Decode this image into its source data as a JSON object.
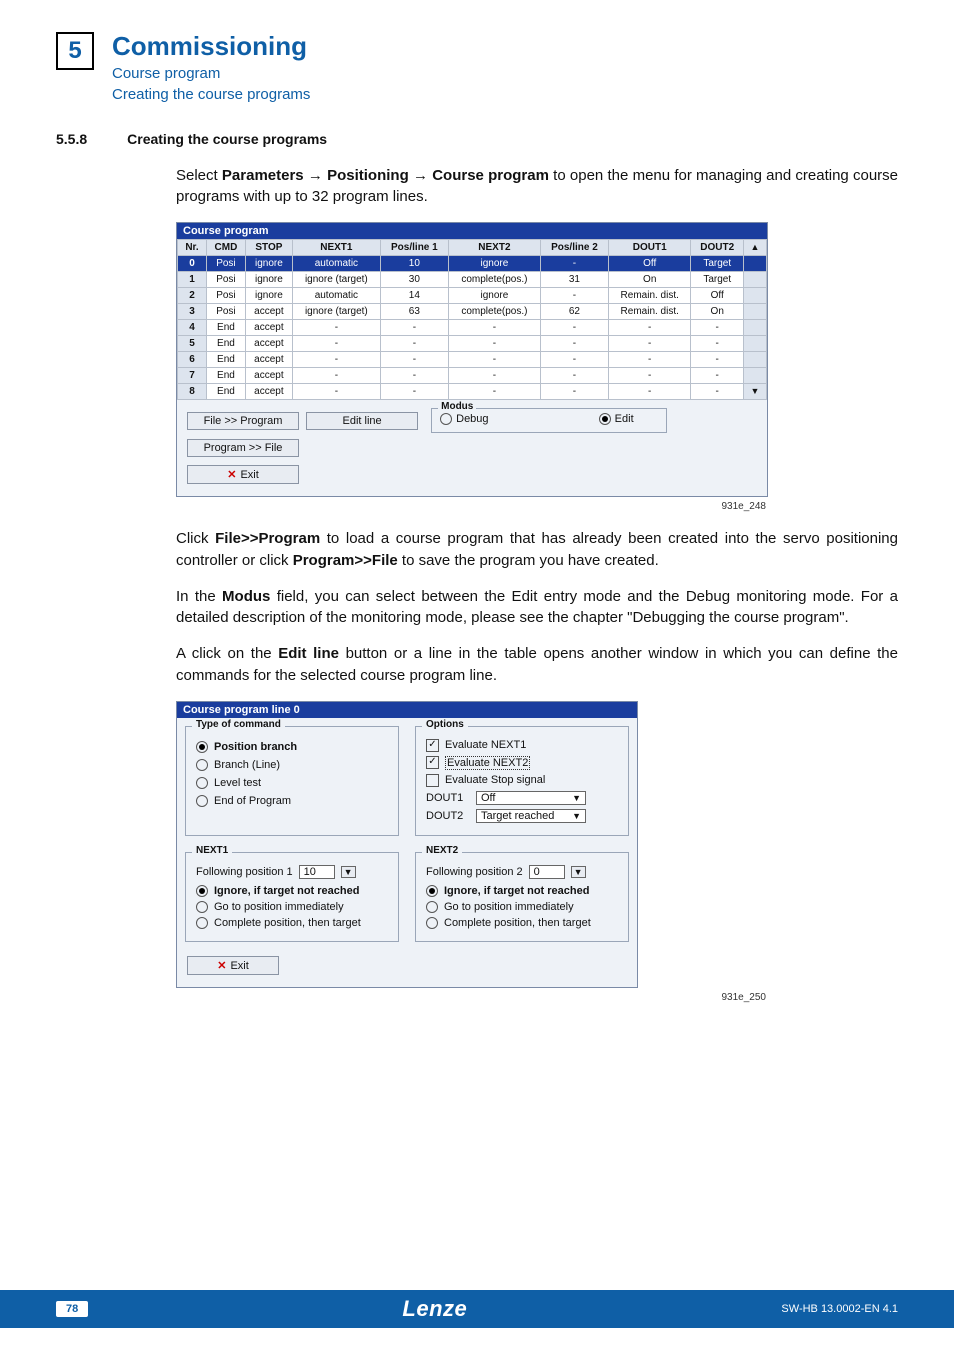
{
  "header": {
    "chapter_number": "5",
    "main_title": "Commissioning",
    "subtitle_1": "Course program",
    "subtitle_2": "Creating the course programs"
  },
  "section": {
    "number": "5.5.8",
    "title": "Creating the course programs"
  },
  "paragraphs": {
    "intro": "Select Parameters → Positioning → Course program to open the menu for managing and creating course programs with up to 32 program lines.",
    "intro_prefix": "Select ",
    "intro_bold1": "Parameters → Positioning → Course program",
    "intro_suffix": " to open the menu for managing and creating course programs with up to 32 program lines.",
    "p2_a": "Click ",
    "p2_bold1": "File>>Program",
    "p2_b": " to load a course program that has already been created into the servo positioning controller or click ",
    "p2_bold2": "Program>>File",
    "p2_c": " to save the program you have created.",
    "p3_a": "In the ",
    "p3_bold": "Modus",
    "p3_b": " field, you can select between the Edit entry mode and the Debug monitoring mode. For a detailed description of the monitoring mode, please see the chapter \"Debugging the course program\".",
    "p4_a": "A click on the ",
    "p4_bold": "Edit line",
    "p4_b": " button or a line in the table opens another window in which you can define the commands for the selected course program line."
  },
  "fig_caption_1": "931e_248",
  "fig_caption_2": "931e_250",
  "course_program_window": {
    "title": "Course program",
    "columns": [
      "Nr.",
      "CMD",
      "STOP",
      "NEXT1",
      "Pos/line 1",
      "NEXT2",
      "Pos/line 2",
      "DOUT1",
      "DOUT2"
    ],
    "rows": [
      {
        "nr": "0",
        "cmd": "Posi",
        "stop": "ignore",
        "next1": "automatic",
        "pl1": "10",
        "next2": "ignore",
        "pl2": "-",
        "d1": "Off",
        "d2": "Target",
        "hl": true
      },
      {
        "nr": "1",
        "cmd": "Posi",
        "stop": "ignore",
        "next1": "ignore (target)",
        "pl1": "30",
        "next2": "complete(pos.)",
        "pl2": "31",
        "d1": "On",
        "d2": "Target"
      },
      {
        "nr": "2",
        "cmd": "Posi",
        "stop": "ignore",
        "next1": "automatic",
        "pl1": "14",
        "next2": "ignore",
        "pl2": "-",
        "d1": "Remain. dist.",
        "d2": "Off"
      },
      {
        "nr": "3",
        "cmd": "Posi",
        "stop": "accept",
        "next1": "ignore (target)",
        "pl1": "63",
        "next2": "complete(pos.)",
        "pl2": "62",
        "d1": "Remain. dist.",
        "d2": "On"
      },
      {
        "nr": "4",
        "cmd": "End",
        "stop": "accept",
        "next1": "-",
        "pl1": "-",
        "next2": "-",
        "pl2": "-",
        "d1": "-",
        "d2": "-"
      },
      {
        "nr": "5",
        "cmd": "End",
        "stop": "accept",
        "next1": "-",
        "pl1": "-",
        "next2": "-",
        "pl2": "-",
        "d1": "-",
        "d2": "-"
      },
      {
        "nr": "6",
        "cmd": "End",
        "stop": "accept",
        "next1": "-",
        "pl1": "-",
        "next2": "-",
        "pl2": "-",
        "d1": "-",
        "d2": "-"
      },
      {
        "nr": "7",
        "cmd": "End",
        "stop": "accept",
        "next1": "-",
        "pl1": "-",
        "next2": "-",
        "pl2": "-",
        "d1": "-",
        "d2": "-"
      },
      {
        "nr": "8",
        "cmd": "End",
        "stop": "accept",
        "next1": "-",
        "pl1": "-",
        "next2": "-",
        "pl2": "-",
        "d1": "-",
        "d2": "-"
      }
    ],
    "buttons": {
      "file_to_program": "File >> Program",
      "edit_line": "Edit line",
      "program_to_file": "Program >> File",
      "exit": "Exit"
    },
    "modus": {
      "legend": "Modus",
      "debug_label": "Debug",
      "edit_label": "Edit",
      "debug_checked": false,
      "edit_checked": true
    }
  },
  "line_window": {
    "title": "Course program line 0",
    "type_of_command": {
      "legend": "Type of command",
      "options": [
        {
          "label": "Position branch",
          "checked": true
        },
        {
          "label": "Branch (Line)",
          "checked": false
        },
        {
          "label": "Level test",
          "checked": false
        },
        {
          "label": "End of Program",
          "checked": false
        }
      ]
    },
    "options_box": {
      "legend": "Options",
      "eval_next1": {
        "label": "Evaluate NEXT1",
        "checked": true
      },
      "eval_next2": {
        "label": "Evaluate NEXT2",
        "checked": true
      },
      "eval_stop": {
        "label": "Evaluate Stop signal",
        "checked": false
      },
      "dout1_label": "DOUT1",
      "dout1_value": "Off",
      "dout2_label": "DOUT2",
      "dout2_value": "Target reached"
    },
    "next1": {
      "legend": "NEXT1",
      "follow_label": "Following position 1",
      "follow_value": "10",
      "radios": [
        {
          "label": "Ignore, if target not reached",
          "checked": true
        },
        {
          "label": "Go to position immediately",
          "checked": false
        },
        {
          "label": "Complete position, then target",
          "checked": false
        }
      ]
    },
    "next2": {
      "legend": "NEXT2",
      "follow_label": "Following position 2",
      "follow_value": "0",
      "radios": [
        {
          "label": "Ignore, if target not reached",
          "checked": true
        },
        {
          "label": "Go to position immediately",
          "checked": false
        },
        {
          "label": "Complete position, then target",
          "checked": false
        }
      ]
    },
    "exit_label": "Exit"
  },
  "footer": {
    "page_number": "78",
    "logo_text": "Lenze",
    "doc_id": "SW-HB 13.0002-EN   4.1"
  }
}
